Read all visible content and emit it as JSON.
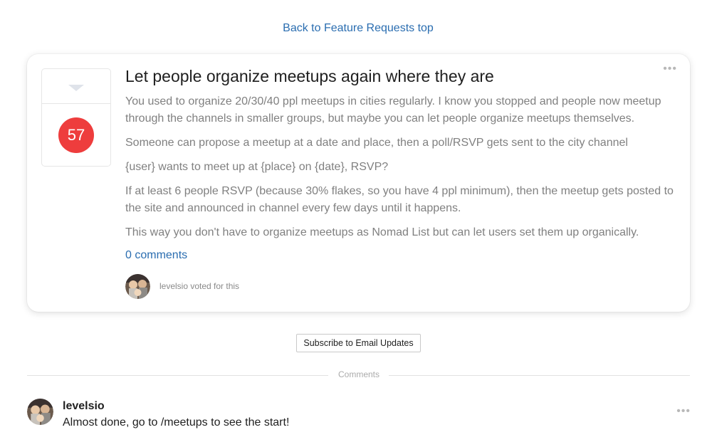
{
  "nav": {
    "back_link": "Back to Feature Requests top"
  },
  "post": {
    "vote_count": "57",
    "title": "Let people organize meetups again where they are",
    "paragraphs": [
      "You used to organize 20/30/40 ppl meetups in cities regularly. I know you stopped and people now meetup through the channels in smaller groups, but maybe you can let people organize meetups themselves.",
      "Someone can propose a meetup at a date and place, then a poll/RSVP gets sent to the city channel",
      "{user} wants to meet up at {place} on {date}, RSVP?",
      "If at least 6 people RSVP (because 30% flakes, so you have 4 ppl minimum), then the meetup gets posted to the site and announced in channel every few days until it happens.",
      "This way you don't have to organize meetups as Nomad List but can let users set them up organically."
    ],
    "comments_link": "0 comments",
    "voter_text": "levelsio voted for this",
    "menu_glyph": "•••"
  },
  "subscribe": {
    "label": "Subscribe to Email Updates"
  },
  "comments_section": {
    "divider_label": "Comments",
    "items": [
      {
        "author": "levelsio",
        "text": "Almost done, go to /meetups to see the start!",
        "menu_glyph": "•••"
      }
    ]
  },
  "colors": {
    "link": "#2a6db0",
    "vote_badge": "#ee3d3d",
    "body_text": "#808080"
  },
  "icons": {
    "upvote": "upvote-triangle-icon",
    "menu": "more-options-icon",
    "avatar": "user-avatar"
  }
}
